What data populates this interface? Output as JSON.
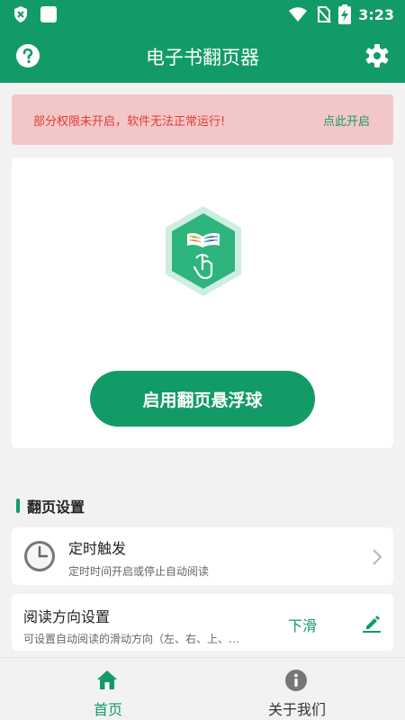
{
  "status_bar": {
    "time": "3:23",
    "left_icons": [
      "shield-icon",
      "square-icon"
    ],
    "right_icons": [
      "wifi-icon",
      "no-sim-icon",
      "battery-charging-icon"
    ]
  },
  "app_bar": {
    "title": "电子书翻页器",
    "left_icon": "help-icon",
    "right_icon": "gear-icon"
  },
  "permission_banner": {
    "message": "部分权限未开启，软件无法正常运行!",
    "action_label": "点此开启",
    "message_color": "#e53935",
    "background_color": "#f3c7c8"
  },
  "hero": {
    "logo_icon": "book-page-turn-logo-icon",
    "primary_button_label": "启用翻页悬浮球"
  },
  "page_settings": {
    "section_title": "翻页设置",
    "items": [
      {
        "title": "定时触发",
        "subtitle": "定时时间开启或停止自动阅读",
        "icon": "clock-icon",
        "trailing_icon": "chevron-right-icon"
      },
      {
        "title": "阅读方向设置",
        "subtitle": "可设置自动阅读的滑动方向（左、右、上、…",
        "value": "下滑",
        "trailing_icon": "edit-icon"
      }
    ]
  },
  "bottom_nav": {
    "items": [
      {
        "label": "首页",
        "icon": "home-icon",
        "active": true
      },
      {
        "label": "关于我们",
        "icon": "info-icon",
        "active": false
      }
    ]
  },
  "colors": {
    "brand_green": "#129b66",
    "background": "#f2f2f2",
    "card": "#ffffff"
  }
}
